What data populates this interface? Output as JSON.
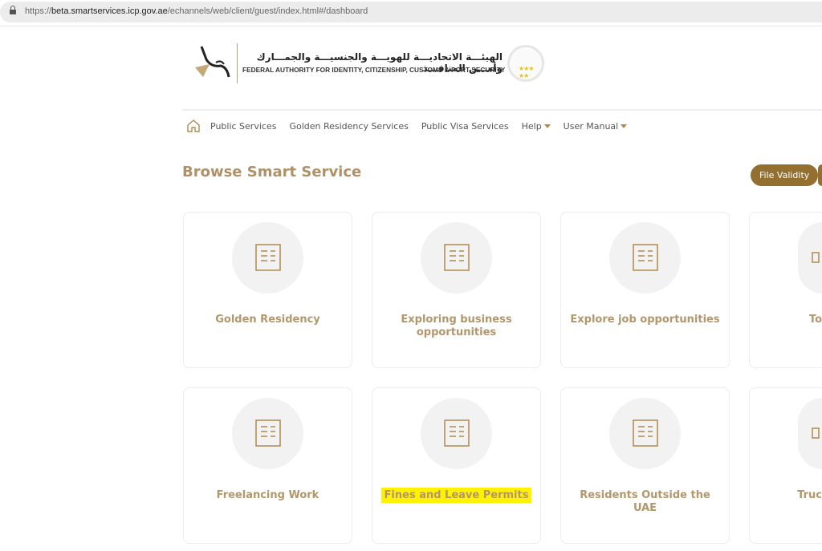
{
  "browser": {
    "url_prefix": "https://",
    "url_host": "beta.smartservices.icp.gov.ae",
    "url_path": "/echannels/web/client/guest/index.html#/dashboard"
  },
  "header": {
    "logo_arabic": "الهيئـــة الاتحاديـــة للهويـــة والجنسيـــة والجمـــارك وأمـــن المنافـــذ",
    "logo_english": "FEDERAL AUTHORITY FOR IDENTITY, CITIZENSHIP, CUSTOMS & PORT SECURITY"
  },
  "nav": {
    "items": [
      "Public Services",
      "Golden Residency Services",
      "Public Visa Services",
      "Help",
      "User Manual"
    ]
  },
  "page": {
    "title": "Browse Smart Service",
    "buttons": [
      "File Validity"
    ]
  },
  "cards": [
    {
      "label": "Golden Residency",
      "icon": "golden-residency-icon"
    },
    {
      "label": "Exploring business opportunities",
      "icon": "business-building-icon"
    },
    {
      "label": "Explore job opportunities",
      "icon": "office-building-icon"
    },
    {
      "label": "To",
      "icon": "tourism-icon"
    },
    {
      "label": "Freelancing Work",
      "icon": "freelance-desk-icon"
    },
    {
      "label": "Fines and Leave Permits",
      "icon": "stamp-icon",
      "highlighted": true
    },
    {
      "label": "Residents Outside the UAE",
      "icon": "residents-icon"
    },
    {
      "label": "Truc",
      "icon": "truck-icon"
    }
  ],
  "colors": {
    "accent": "#93702f",
    "card_text": "#b4966b",
    "highlight": "#fff200"
  }
}
